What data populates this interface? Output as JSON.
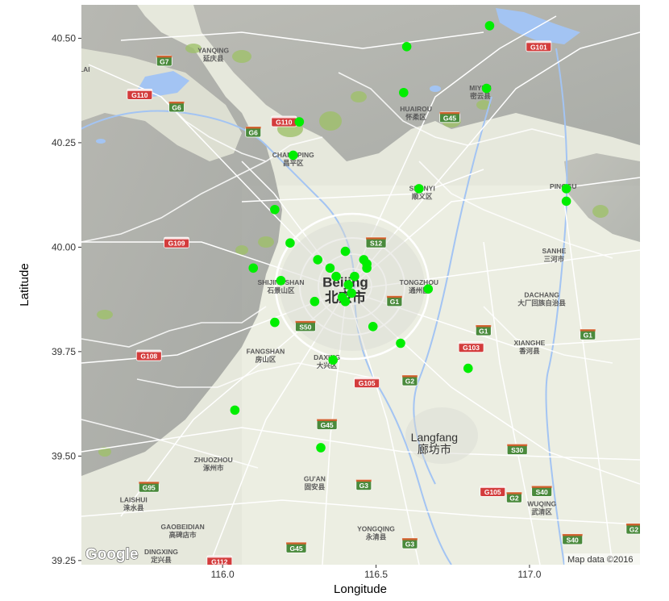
{
  "chart_data": {
    "type": "scatter",
    "title": "",
    "xlabel": "Longitude",
    "ylabel": "Latitude",
    "xlim": [
      115.54,
      117.36
    ],
    "ylim": [
      39.24,
      40.58
    ],
    "xticks": [
      116.0,
      116.5,
      117.0
    ],
    "xtick_labels": [
      "116.0",
      "116.5",
      "117.0"
    ],
    "yticks": [
      39.25,
      39.5,
      39.75,
      40.0,
      40.25,
      40.5
    ],
    "ytick_labels": [
      "39.25",
      "39.50",
      "39.75",
      "40.00",
      "40.25",
      "40.50"
    ],
    "point_color": "#00ee00",
    "grid": false,
    "legend": "none",
    "points": {
      "x": [
        116.87,
        116.6,
        116.59,
        116.86,
        116.25,
        116.23,
        116.64,
        117.12,
        117.12,
        116.17,
        116.22,
        116.1,
        116.19,
        116.31,
        116.4,
        116.35,
        116.37,
        116.46,
        116.47,
        116.47,
        116.43,
        116.41,
        116.42,
        116.39,
        116.4,
        116.3,
        116.17,
        116.67,
        116.49,
        116.58,
        116.04,
        116.36,
        116.32,
        116.8
      ],
      "y": [
        40.53,
        40.48,
        40.37,
        40.38,
        40.3,
        40.22,
        40.14,
        40.14,
        40.11,
        40.09,
        40.01,
        39.95,
        39.92,
        39.97,
        39.99,
        39.95,
        39.93,
        39.97,
        39.96,
        39.95,
        39.93,
        39.91,
        39.89,
        39.88,
        39.87,
        39.87,
        39.82,
        39.9,
        39.81,
        39.77,
        39.61,
        39.73,
        39.52,
        39.71
      ]
    }
  },
  "map": {
    "credit": "Map data ©2016",
    "logo": "Google",
    "places": [
      {
        "name": "Beijing",
        "sub": "北京市",
        "lon": 116.4,
        "lat": 39.905,
        "size": "big"
      },
      {
        "name": "Langfang",
        "sub": "廊坊市",
        "lon": 116.69,
        "lat": 39.535,
        "size": "mid"
      },
      {
        "name": "YANQING",
        "sub": "延庆县",
        "lon": 115.97,
        "lat": 40.465,
        "size": "small"
      },
      {
        "name": "HUAIROU",
        "sub": "怀柔区",
        "lon": 116.63,
        "lat": 40.325,
        "size": "small"
      },
      {
        "name": "MIYUN",
        "sub": "密云县",
        "lon": 116.84,
        "lat": 40.375,
        "size": "small"
      },
      {
        "name": "CHANGPING",
        "sub": "昌平区",
        "lon": 116.23,
        "lat": 40.215,
        "size": "small"
      },
      {
        "name": "SHUNYI",
        "sub": "顺义区",
        "lon": 116.65,
        "lat": 40.135,
        "size": "small"
      },
      {
        "name": "PINGGU",
        "sub": "",
        "lon": 117.11,
        "lat": 40.14,
        "size": "small"
      },
      {
        "name": "SANHE",
        "sub": "三河市",
        "lon": 117.08,
        "lat": 39.985,
        "size": "small"
      },
      {
        "name": "SHIJINGSHAN",
        "sub": "石景山区",
        "lon": 116.19,
        "lat": 39.91,
        "size": "small"
      },
      {
        "name": "TONGZHOU",
        "sub": "通州区",
        "lon": 116.64,
        "lat": 39.91,
        "size": "small"
      },
      {
        "name": "DACHANG",
        "sub": "大厂回族自治县",
        "lon": 117.04,
        "lat": 39.88,
        "size": "small"
      },
      {
        "name": "FANGSHAN",
        "sub": "房山区",
        "lon": 116.14,
        "lat": 39.745,
        "size": "small"
      },
      {
        "name": "DAXING",
        "sub": "大兴区",
        "lon": 116.34,
        "lat": 39.73,
        "size": "small"
      },
      {
        "name": "XIANGHE",
        "sub": "香河县",
        "lon": 117.0,
        "lat": 39.765,
        "size": "small"
      },
      {
        "name": "ZHUOZHOU",
        "sub": "涿州市",
        "lon": 115.97,
        "lat": 39.485,
        "size": "small"
      },
      {
        "name": "GU'AN",
        "sub": "固安县",
        "lon": 116.3,
        "lat": 39.44,
        "size": "small"
      },
      {
        "name": "LAISHUI",
        "sub": "涞水县",
        "lon": 115.71,
        "lat": 39.39,
        "size": "small"
      },
      {
        "name": "WUQING",
        "sub": "武清区",
        "lon": 117.04,
        "lat": 39.38,
        "size": "small"
      },
      {
        "name": "GAOBEIDIAN",
        "sub": "高碑店市",
        "lon": 115.87,
        "lat": 39.325,
        "size": "small"
      },
      {
        "name": "YONGQING",
        "sub": "永清县",
        "lon": 116.5,
        "lat": 39.32,
        "size": "small"
      },
      {
        "name": "DINGXING",
        "sub": "定兴县",
        "lon": 115.8,
        "lat": 39.265,
        "size": "small"
      },
      {
        "name": "LAI",
        "sub": "",
        "lon": 115.55,
        "lat": 40.42,
        "size": "small"
      }
    ],
    "shields": [
      {
        "label": "G7",
        "lon": 115.81,
        "lat": 40.445,
        "color": "#4a8a3c"
      },
      {
        "label": "G110",
        "lon": 115.73,
        "lat": 40.365,
        "color": "#d33c3c"
      },
      {
        "label": "G6",
        "lon": 115.85,
        "lat": 40.335,
        "color": "#4a8a3c"
      },
      {
        "label": "G6",
        "lon": 116.1,
        "lat": 40.275,
        "color": "#4a8a3c"
      },
      {
        "label": "G110",
        "lon": 116.2,
        "lat": 40.3,
        "color": "#d33c3c"
      },
      {
        "label": "G101",
        "lon": 117.03,
        "lat": 40.48,
        "color": "#d33c3c"
      },
      {
        "label": "G45",
        "lon": 116.74,
        "lat": 40.31,
        "color": "#4a8a3c"
      },
      {
        "label": "G109",
        "lon": 115.85,
        "lat": 40.01,
        "color": "#d33c3c"
      },
      {
        "label": "S12",
        "lon": 116.5,
        "lat": 40.01,
        "color": "#4a8a3c"
      },
      {
        "label": "G1",
        "lon": 116.56,
        "lat": 39.87,
        "color": "#4a8a3c"
      },
      {
        "label": "S50",
        "lon": 116.27,
        "lat": 39.81,
        "color": "#4a8a3c"
      },
      {
        "label": "G108",
        "lon": 115.76,
        "lat": 39.74,
        "color": "#d33c3c"
      },
      {
        "label": "G1",
        "lon": 116.85,
        "lat": 39.8,
        "color": "#4a8a3c"
      },
      {
        "label": "G103",
        "lon": 116.81,
        "lat": 39.76,
        "color": "#d33c3c"
      },
      {
        "label": "G1",
        "lon": 117.19,
        "lat": 39.79,
        "color": "#4a8a3c"
      },
      {
        "label": "G105",
        "lon": 116.47,
        "lat": 39.675,
        "color": "#d33c3c"
      },
      {
        "label": "G2",
        "lon": 116.61,
        "lat": 39.68,
        "color": "#4a8a3c"
      },
      {
        "label": "G45",
        "lon": 116.34,
        "lat": 39.575,
        "color": "#4a8a3c"
      },
      {
        "label": "S30",
        "lon": 116.96,
        "lat": 39.515,
        "color": "#4a8a3c"
      },
      {
        "label": "G95",
        "lon": 115.76,
        "lat": 39.425,
        "color": "#4a8a3c"
      },
      {
        "label": "G3",
        "lon": 116.46,
        "lat": 39.43,
        "color": "#4a8a3c"
      },
      {
        "label": "G105",
        "lon": 116.88,
        "lat": 39.415,
        "color": "#d33c3c"
      },
      {
        "label": "S40",
        "lon": 117.04,
        "lat": 39.415,
        "color": "#4a8a3c"
      },
      {
        "label": "G2",
        "lon": 116.95,
        "lat": 39.4,
        "color": "#4a8a3c"
      },
      {
        "label": "G3",
        "lon": 116.61,
        "lat": 39.29,
        "color": "#4a8a3c"
      },
      {
        "label": "G45",
        "lon": 116.24,
        "lat": 39.28,
        "color": "#4a8a3c"
      },
      {
        "label": "S40",
        "lon": 117.14,
        "lat": 39.3,
        "color": "#4a8a3c"
      },
      {
        "label": "G112",
        "lon": 115.99,
        "lat": 39.248,
        "color": "#d33c3c"
      },
      {
        "label": "G2",
        "lon": 117.34,
        "lat": 39.325,
        "color": "#4a8a3c"
      }
    ]
  }
}
